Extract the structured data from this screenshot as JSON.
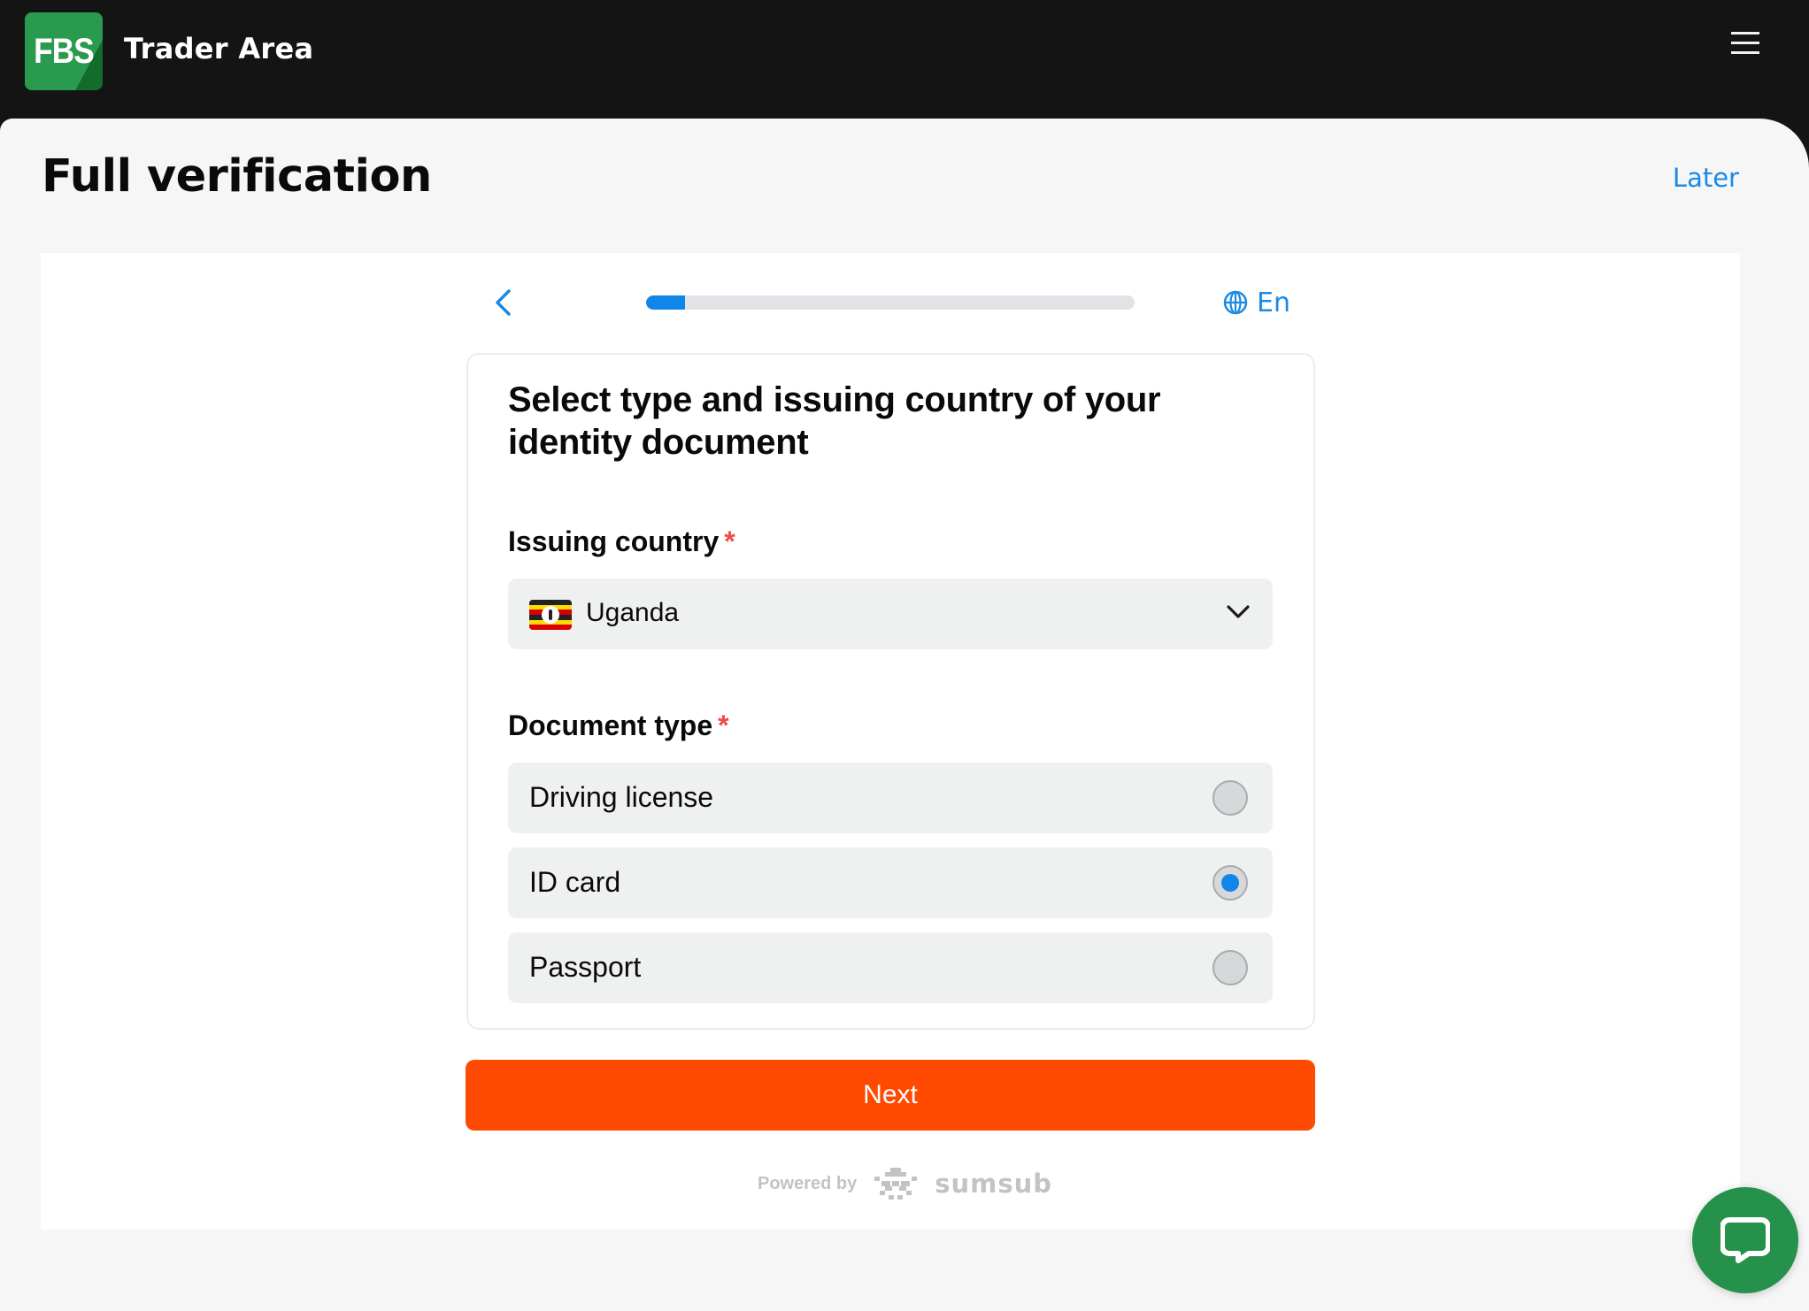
{
  "header": {
    "logo_text": "FBS",
    "app_title": "Trader Area",
    "menu_icon": "hamburger-menu-icon"
  },
  "page": {
    "title": "Full verification",
    "later_label": "Later"
  },
  "stepper": {
    "back_icon": "chevron-left-icon",
    "progress_percent": 8,
    "language_icon": "globe-icon",
    "language_label": "En"
  },
  "form": {
    "heading": "Select type and issuing country of your identity document",
    "country": {
      "label": "Issuing country",
      "required_mark": "*",
      "selected_value": "Uganda",
      "flag": "uganda-flag"
    },
    "document_type": {
      "label": "Document type",
      "required_mark": "*",
      "options": [
        {
          "label": "Driving license",
          "selected": false
        },
        {
          "label": "ID card",
          "selected": true
        },
        {
          "label": "Passport",
          "selected": false
        }
      ]
    },
    "next_label": "Next"
  },
  "footer": {
    "powered_by": "Powered by",
    "brand": "sumsub"
  },
  "colors": {
    "accent_blue": "#1a8ae5",
    "progress_fill": "#0f86e8",
    "primary_button": "#ff4a01",
    "required": "#f04a4a",
    "chat_green": "#25914a",
    "header_bg": "#141414"
  },
  "chat": {
    "icon": "chat-bubble-icon"
  }
}
